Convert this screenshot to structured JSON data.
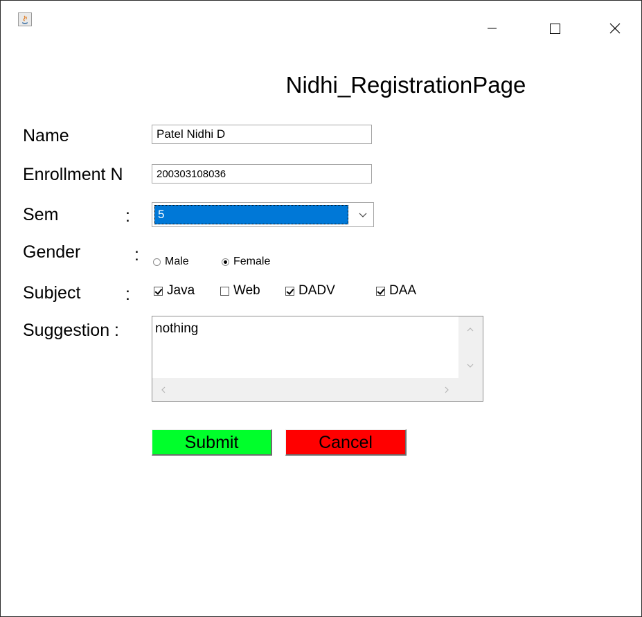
{
  "window": {
    "icon": "java-app-icon"
  },
  "form": {
    "title": "Nidhi_RegistrationPage",
    "name_label": "Name",
    "name_value": "Patel Nidhi D",
    "enrollment_label": "Enrollment N",
    "enrollment_value": "200303108036",
    "sem_label": "Sem",
    "sem_colon": ":",
    "sem_selected": "5",
    "gender_label": "Gender",
    "gender_colon": ":",
    "gender_options": [
      {
        "label": "Male",
        "checked": false
      },
      {
        "label": "Female",
        "checked": true
      }
    ],
    "subject_label": "Subject",
    "subject_colon": ":",
    "subjects": [
      {
        "label": "Java",
        "checked": true
      },
      {
        "label": "Web",
        "checked": false
      },
      {
        "label": "DADV",
        "checked": true
      },
      {
        "label": "DAA",
        "checked": true
      }
    ],
    "suggestion_label": "Suggestion :",
    "suggestion_value": "nothing",
    "submit_label": "Submit",
    "cancel_label": "Cancel"
  },
  "colors": {
    "submit_bg": "#00ff2b",
    "cancel_bg": "#ff0000",
    "selection": "#0078d7"
  }
}
